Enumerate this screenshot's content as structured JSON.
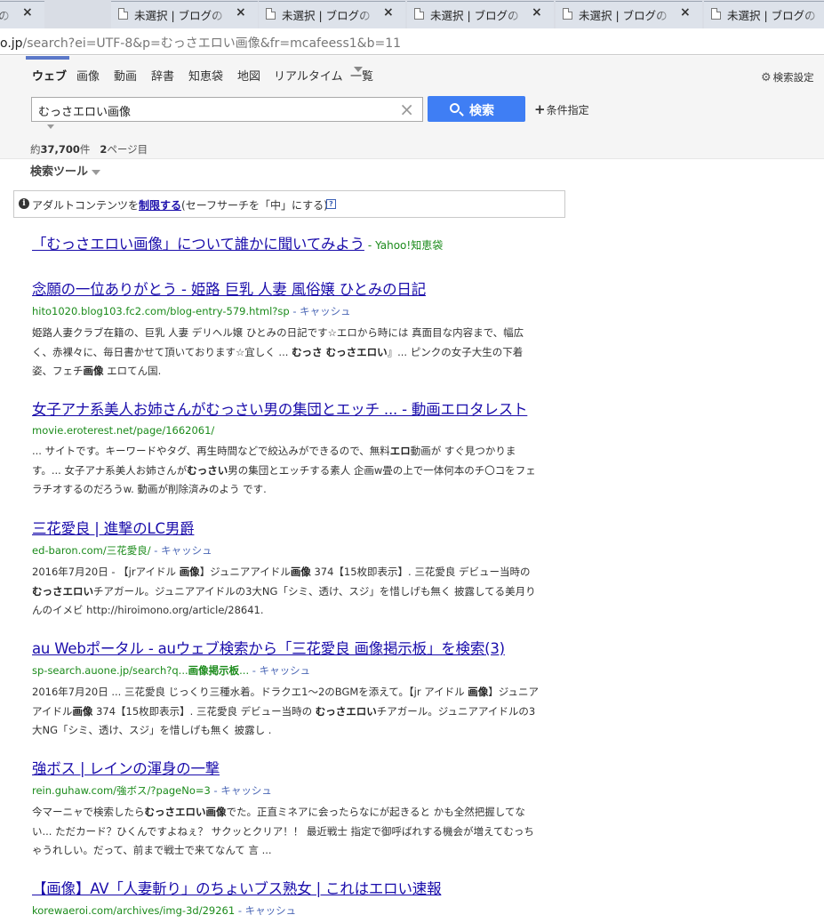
{
  "browser": {
    "tabs": [
      {
        "title": "未選択 | ブログの",
        "close": "×"
      },
      {
        "title": "未選択 | ブログの",
        "close": "×"
      },
      {
        "title": "未選択 | ブログの",
        "close": "×"
      },
      {
        "title": "未選択 | ブログの",
        "close": "×"
      },
      {
        "title": "未選択 | ブログの",
        "close": "×"
      },
      {
        "title": "未選択 | ブログの",
        "close": "×"
      }
    ],
    "url_host": "o.jp",
    "url_rest": "/search?ei=UTF-8&p=むっさエロい画像&fr=mcafeess1&b=11"
  },
  "nav": {
    "items": [
      "ウェブ",
      "画像",
      "動画",
      "辞書",
      "知恵袋",
      "地図",
      "リアルタイム",
      "一覧"
    ],
    "search_settings": "検索設定"
  },
  "search": {
    "query": "むっさエロい画像",
    "clear": "×",
    "button_label": "検索",
    "conditions_label": "条件指定"
  },
  "stats": {
    "prefix": "約",
    "count": "37,700",
    "unit": "件",
    "page_num": "2",
    "page_label": "ページ目"
  },
  "tools": {
    "label": "検索ツール"
  },
  "notice": {
    "pre": "アダルトコンテンツを",
    "link": "制限する",
    "post": "(セーフサーチを「中」にする)",
    "help": "?"
  },
  "chiebukuro": {
    "title": "「むっさエロい画像」について誰かに聞いてみよう",
    "source": "- Yahoo!知恵袋"
  },
  "results": [
    {
      "title": "念願の一位ありがとう - 姫路 巨乳 人妻 風俗嬢 ひとみの日記",
      "url": "hito1020.blog103.fc2.com/blog-entry-579.html?sp",
      "cache": " - キャッシュ",
      "snippet_html": "姫路人妻クラブ在籍の、巨乳 人妻 デリヘル嬢 ひとみの日記です☆エロから時には 真面目な内容まで、幅広く、赤裸々に、毎日書かせて頂いております☆宜しく ... <b>むっさ むっさエロい</b>』... ピンクの女子大生の下着姿、フェチ<b>画像</b> エロてん国."
    },
    {
      "title": "女子アナ系美人お姉さんがむっさい男の集団とエッチ ... - 動画エロタレスト",
      "url": "movie.eroterest.net/page/1662061/",
      "cache": "",
      "snippet_html": "... サイトです。キーワードやタグ、再生時間などで絞込みができるので、無料<b>エロ</b>動画が すぐ見つかります。... 女子アナ系美人お姉さんが<b>むっさい</b>男の集団とエッチする素人 企画w畳の上で一体何本のチ〇コをフェラチオするのだろうw. 動画が削除済みのよう です."
    },
    {
      "title": "三花愛良 | 進撃のLC男爵",
      "url": "ed-baron.com/三花愛良/",
      "cache": " - キャッシュ",
      "snippet_html": "2016年7月20日 - 【jrアイドル <b>画像</b>】ジュニアアイドル<b>画像</b> 374【15枚即表示】. 三花愛良 デビュー当時の <b>むっさエロい</b>チアガール。ジュニアアイドルの3大NG「シミ、透け、スジ」を惜しげも無く 披露してる美月りんのイメビ http://hiroimono.org/article/28641."
    },
    {
      "title": "au Webポータル - auウェブ検索から「三花愛良 画像掲示板」を検索(3)",
      "url": "sp-search.auone.jp/search?q...",
      "url_bold": "画像掲示板",
      "url_after": "...",
      "cache": " - キャッシュ",
      "snippet_html": "2016年7月20日 ... 三花愛良 じっくり三種水着。ドラクエ1～2のBGMを添えて。【jr アイドル <b>画像</b>】ジュニアアイドル<b>画像</b> 374【15枚即表示】. 三花愛良 デビュー当時の <b>むっさエロい</b>チアガール。ジュニアアイドルの3大NG「シミ、透け、スジ」を惜しげも無く 披露し ."
    },
    {
      "title": "強ボス | レインの渾身の一撃",
      "url": "rein.guhaw.com/強ボス/?pageNo=3",
      "cache": " - キャッシュ",
      "snippet_html": "今マーニャで検索したら<b>むっさエロい画像</b>でた。正直ミネアに会ったらなにが起きると かも全然把握してない... ただカード？ひくんですよねぇ？ サクッとクリア！！ 最近戦士 指定で御呼ばれする機会が増えてむっちゃうれしい。だって、前まで戦士で来てなんて 言 ..."
    },
    {
      "title": "【画像】AV「人妻斬り」のちょいブス熟女 | これはエロい速報",
      "url": "korewaeroi.com/archives/img-3d/29261",
      "cache": " - キャッシュ",
      "snippet_html": ""
    }
  ]
}
